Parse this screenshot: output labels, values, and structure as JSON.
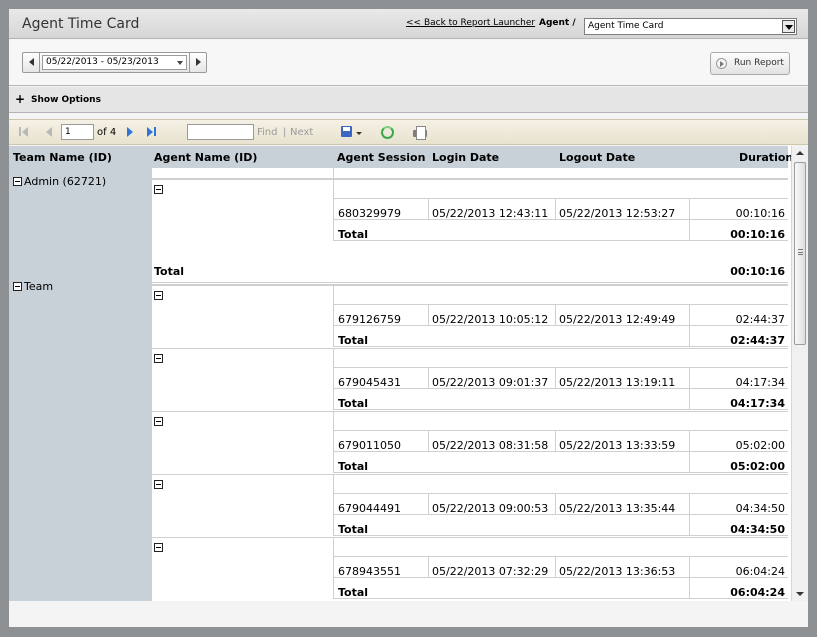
{
  "header": {
    "title": "Agent Time Card",
    "back_link": "<< Back to Report Launcher",
    "agent_label": "Agent /",
    "agent_select": "Agent Time Card"
  },
  "datebar": {
    "date_range": "05/22/2013 - 05/23/2013",
    "run_report": "Run Report"
  },
  "options": {
    "label": "Show Options"
  },
  "toolbar": {
    "page_value": "1",
    "page_of": "of 4",
    "find": "Find",
    "separator": "|",
    "next": "Next"
  },
  "table": {
    "headers": [
      "Team Name (ID)",
      "Agent Name (ID)",
      "Agent Session",
      "Login Date",
      "Logout Date",
      "Duration"
    ],
    "teams": [
      {
        "name": "Admin (62721)"
      },
      {
        "name": "Team"
      }
    ],
    "team_total_label": "Total",
    "total_label": "Total",
    "admin_total_duration": "00:10:16",
    "sessions": [
      {
        "session": "680329979",
        "login": "05/22/2013 12:43:11",
        "logout": "05/22/2013 12:53:27",
        "duration": "00:10:16",
        "total": "00:10:16"
      },
      {
        "session": "679126759",
        "login": "05/22/2013 10:05:12",
        "logout": "05/22/2013 12:49:49",
        "duration": "02:44:37",
        "total": "02:44:37"
      },
      {
        "session": "679045431",
        "login": "05/22/2013 09:01:37",
        "logout": "05/22/2013 13:19:11",
        "duration": "04:17:34",
        "total": "04:17:34"
      },
      {
        "session": "679011050",
        "login": "05/22/2013 08:31:58",
        "logout": "05/22/2013 13:33:59",
        "duration": "05:02:00",
        "total": "05:02:00"
      },
      {
        "session": "679044491",
        "login": "05/22/2013 09:00:53",
        "logout": "05/22/2013 13:35:44",
        "duration": "04:34:50",
        "total": "04:34:50"
      },
      {
        "session": "678943551",
        "login": "05/22/2013 07:32:29",
        "logout": "05/22/2013 13:36:53",
        "duration": "06:04:24",
        "total": "06:04:24"
      }
    ]
  }
}
